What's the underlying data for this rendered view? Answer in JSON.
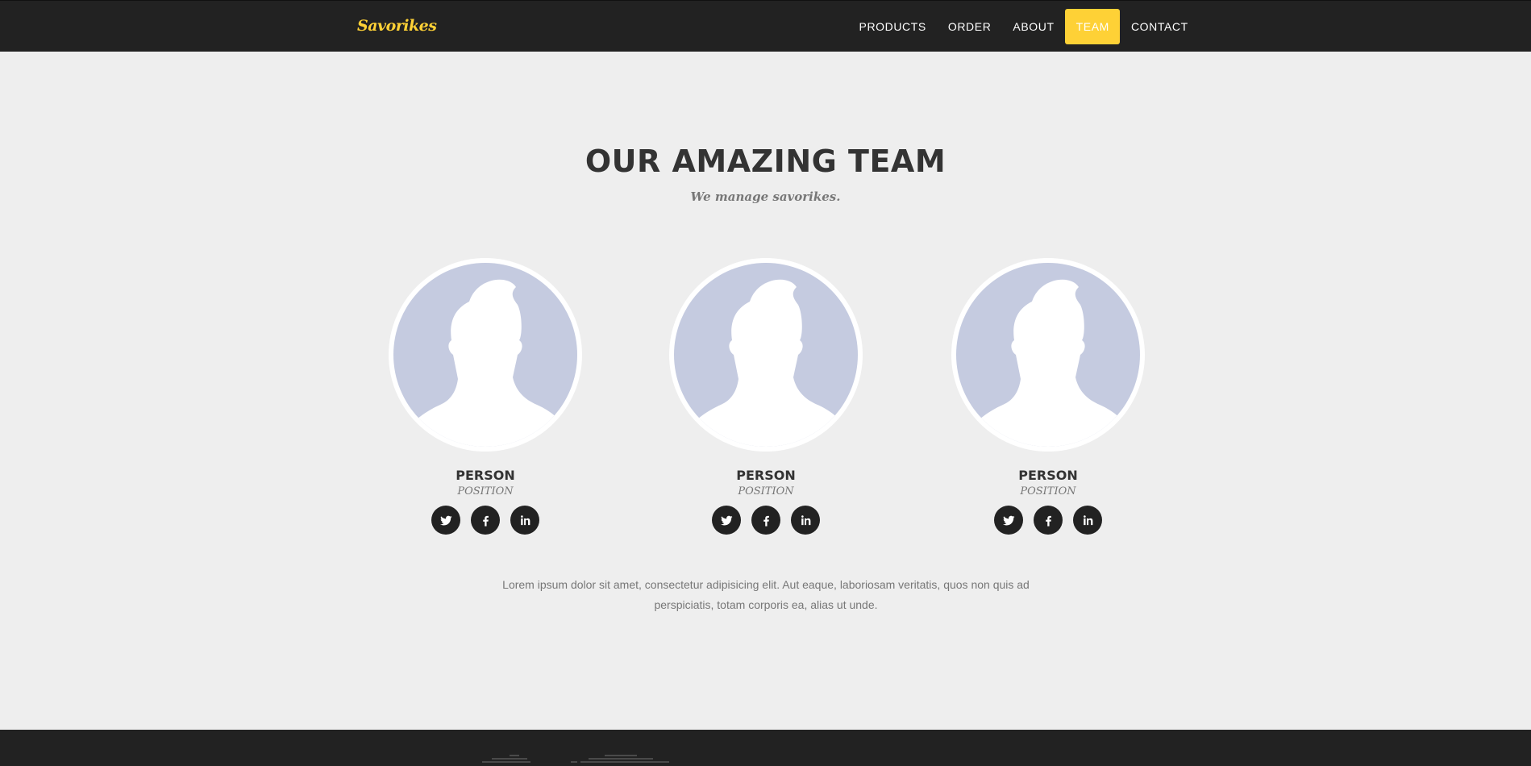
{
  "brand": {
    "name": "Savorikes"
  },
  "nav": {
    "items": [
      {
        "label": "PRODUCTS",
        "active": false
      },
      {
        "label": "ORDER",
        "active": false
      },
      {
        "label": "ABOUT",
        "active": false
      },
      {
        "label": "TEAM",
        "active": true
      },
      {
        "label": "CONTACT",
        "active": false
      }
    ]
  },
  "team": {
    "title": "OUR AMAZING TEAM",
    "subtitle": "We manage savorikes.",
    "members": [
      {
        "name": "PERSON",
        "position": "POSITION",
        "socials": [
          "twitter-icon",
          "facebook-icon",
          "linkedin-icon"
        ]
      },
      {
        "name": "PERSON",
        "position": "POSITION",
        "socials": [
          "twitter-icon",
          "facebook-icon",
          "linkedin-icon"
        ]
      },
      {
        "name": "PERSON",
        "position": "POSITION",
        "socials": [
          "twitter-icon",
          "facebook-icon",
          "linkedin-icon"
        ]
      }
    ],
    "description": "Lorem ipsum dolor sit amet, consectetur adipisicing elit. Aut eaque, laboriosam veritatis, quos non quis ad perspiciatis, totam corporis ea, alias ut unde."
  },
  "colors": {
    "accent": "#fed136",
    "dark": "#222222",
    "background": "#eeeeee",
    "avatar_bg": "#c5cbe0"
  }
}
